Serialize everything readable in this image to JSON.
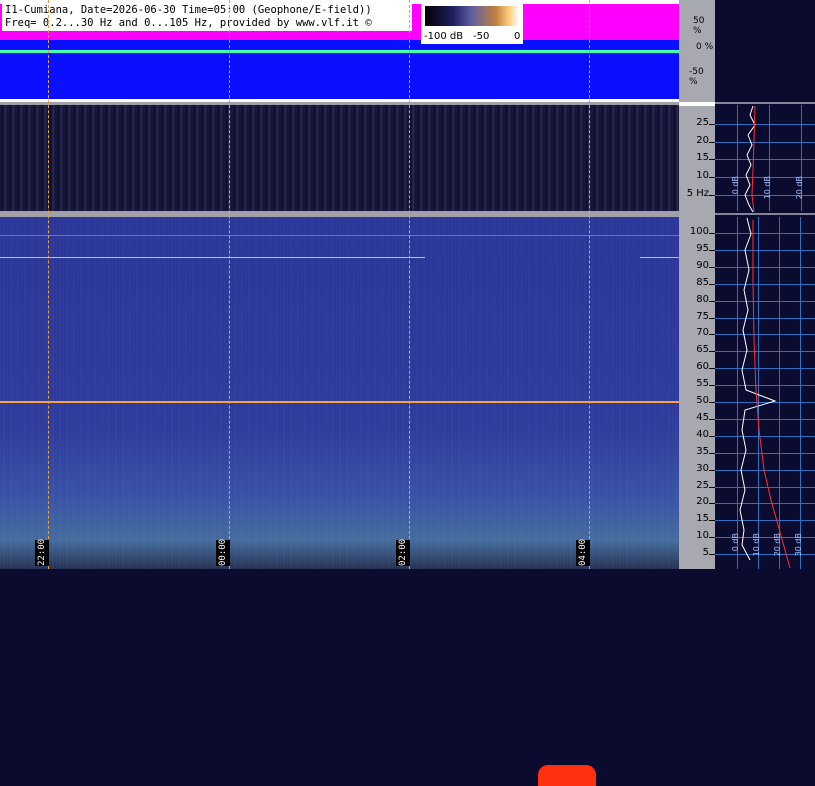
{
  "title": {
    "line1": "I1-Cumiana, Date=2026-06-30 Time=05:00 (Geophone/E-field))",
    "line2": "Freq= 0.2...30 Hz and 0...105 Hz, provided by www.vlf.it ©"
  },
  "colorbar": {
    "labels": [
      "-100 dB",
      "-50",
      "0"
    ],
    "colors": [
      "#000000",
      "#202060",
      "#6060a0",
      "#c08040",
      "#ffd080",
      "#ffffff"
    ]
  },
  "amplitude_axis": {
    "labels": [
      "50 %",
      "0 %",
      "-50 %"
    ]
  },
  "geophone_axis": {
    "labels": [
      "25",
      "20",
      "15",
      "10",
      "5 Hz"
    ]
  },
  "main_axis": {
    "labels": [
      "100",
      "95",
      "90",
      "85",
      "80",
      "75",
      "70",
      "65",
      "60",
      "55",
      "50",
      "45",
      "40",
      "35",
      "30",
      "25",
      "20",
      "15",
      "10",
      "5"
    ]
  },
  "time_labels": [
    "22:00",
    "00:00",
    "02:00",
    "04:00"
  ],
  "spectrum_db_labels": {
    "geophone": [
      "0 dB",
      "10 dB",
      "20 dB"
    ],
    "main": [
      "0 dB",
      "10 dB",
      "20 dB",
      "30 dB"
    ]
  },
  "colors": {
    "amplitude_bg": "#0a10ff",
    "amplitude_trace": "#ff00ff",
    "axis_bg": "#a8a8b0",
    "spectrum_grid": "#3070c0",
    "line_50hz": "#ffa040"
  }
}
